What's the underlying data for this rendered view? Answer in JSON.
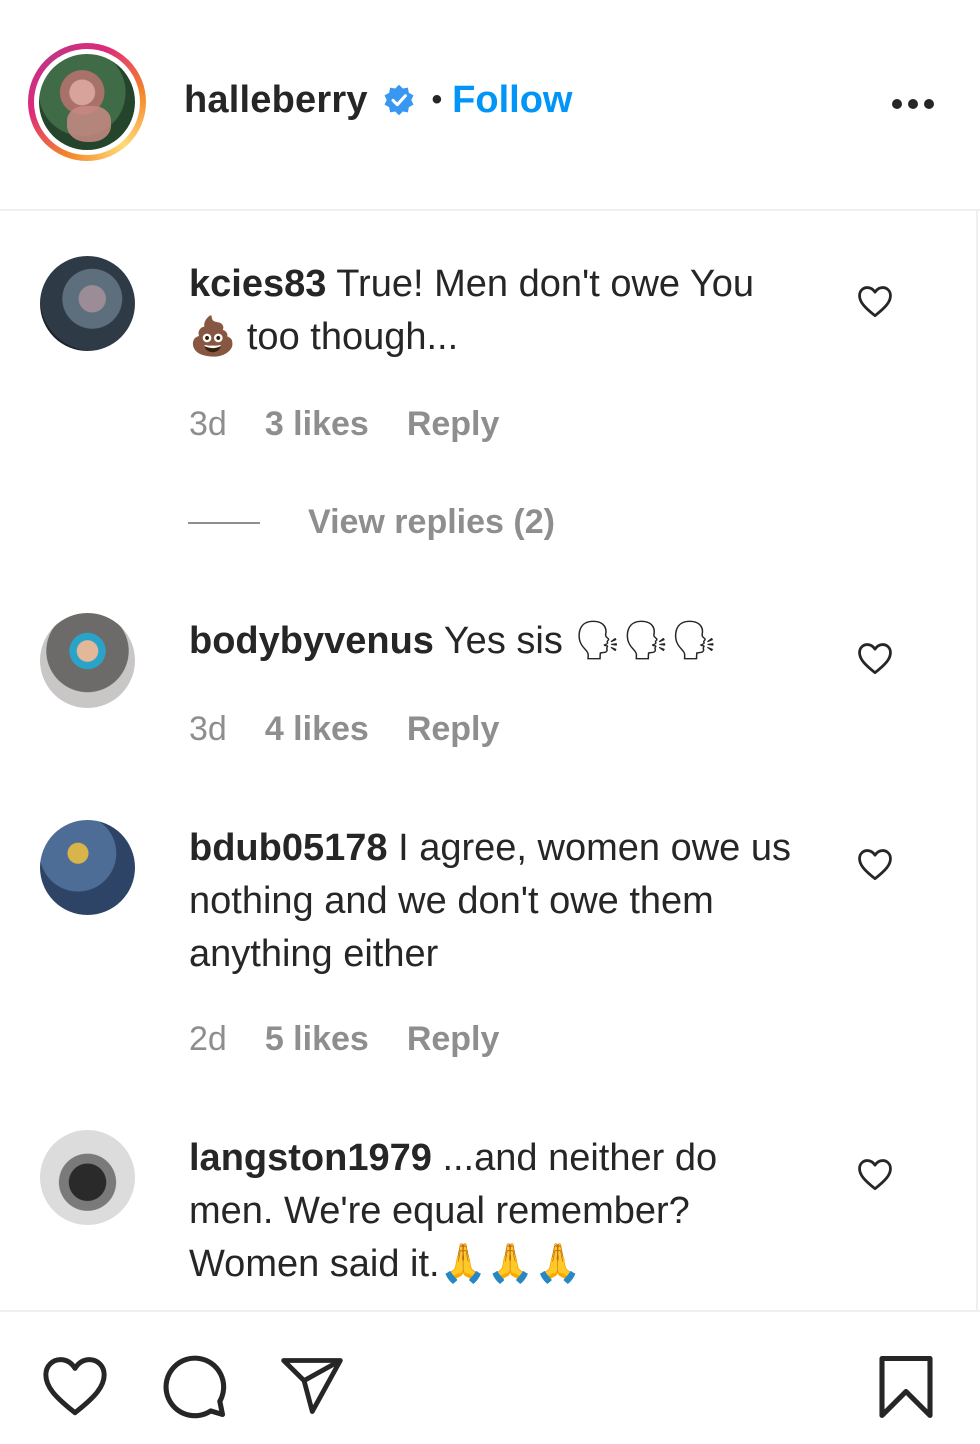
{
  "post_owner": {
    "username": "halleberry",
    "separator": "•",
    "follow_label": "Follow"
  },
  "colors": {
    "follow_blue": "#0095f6",
    "meta_gray": "#8e8e8e",
    "text": "#262626"
  },
  "comments": [
    {
      "username": "kcies83",
      "text": "True! Men don't owe You 💩 too though...",
      "time": "3d",
      "likes": "3 likes",
      "reply_label": "Reply",
      "view_replies": "View replies (2)"
    },
    {
      "username": "bodybyvenus",
      "text": "Yes sis 🗣🗣🗣",
      "time": "3d",
      "likes": "4 likes",
      "reply_label": "Reply"
    },
    {
      "username": "bdub05178",
      "text": "I agree, women owe us nothing and we don't owe them anything either",
      "time": "2d",
      "likes": "5 likes",
      "reply_label": "Reply"
    },
    {
      "username": "langston1979",
      "text": "...and neither do men. We're equal remember? Women said it.🙏🙏🙏"
    }
  ],
  "icons": {
    "more": "more-options-icon",
    "like": "heart-icon",
    "comment": "comment-bubble-icon",
    "share": "paper-plane-icon",
    "save": "bookmark-icon",
    "verified": "verified-badge-icon"
  }
}
